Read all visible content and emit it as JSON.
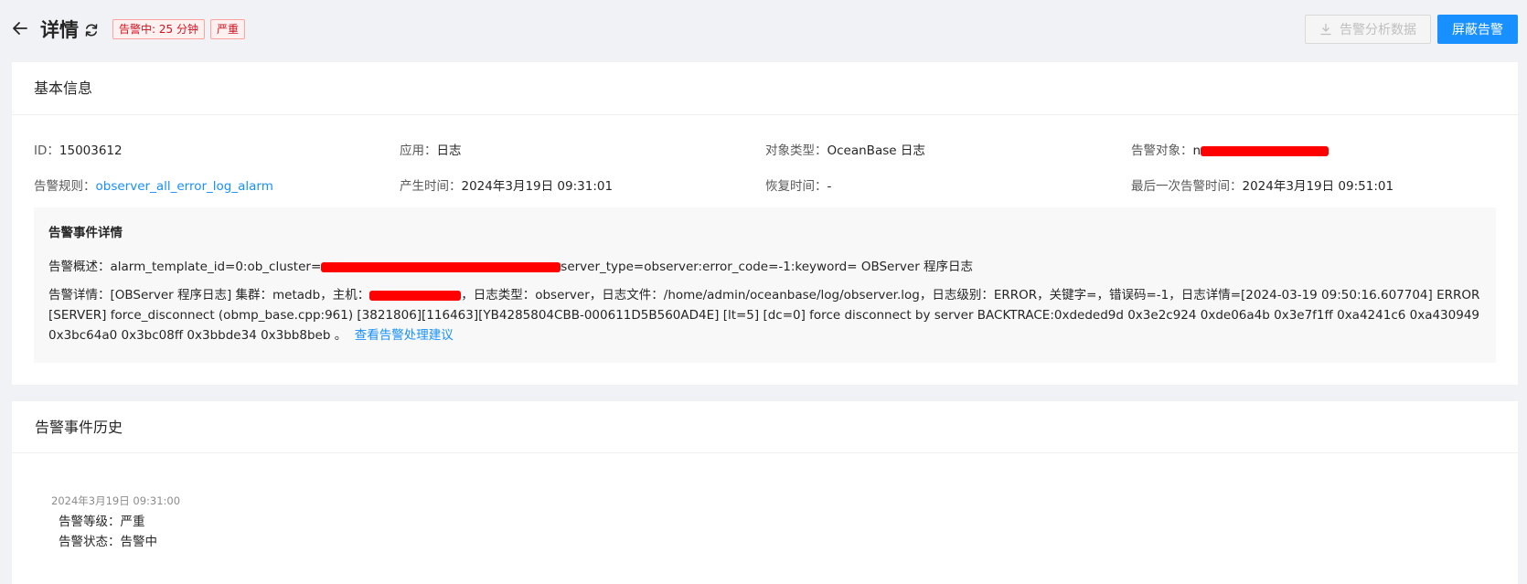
{
  "header": {
    "title": "详情",
    "tags": [
      "告警中: 25 分钟",
      "严重"
    ],
    "analysis_button": "告警分析数据",
    "mask_button": "屏蔽告警"
  },
  "basic": {
    "section_title": "基本信息",
    "id_label": "ID：",
    "id_value": "15003612",
    "app_label": "应用：",
    "app_value": "日志",
    "object_type_label": "对象类型：",
    "object_type_value": "OceanBase 日志",
    "target_label": "告警对象：",
    "target_prefix": "n",
    "rule_label": "告警规则：",
    "rule_value": "observer_all_error_log_alarm",
    "created_label": "产生时间：",
    "created_value": "2024年3月19日 09:31:01",
    "recovered_label": "恢复时间：",
    "recovered_value": "-",
    "last_label": "最后一次告警时间：",
    "last_value": "2024年3月19日 09:51:01"
  },
  "event": {
    "title": "告警事件详情",
    "summary_label": "告警概述：",
    "summary_before": "alarm_template_id=0:ob_cluster=",
    "summary_after": "server_type=observer:error_code=-1:keyword= OBServer 程序日志",
    "detail_label": "告警详情：",
    "detail_before": "[OBServer 程序日志] 集群：metadb，主机：",
    "detail_after": "，日志类型：observer，日志文件：/home/admin/oceanbase/log/observer.log，日志级别：ERROR，关键字=，错误码=-1，日志详情=[2024-03-19 09:50:16.607704] ERROR [SERVER] force_disconnect (obmp_base.cpp:961) [3821806][116463][YB4285804CBB-000611D5B560AD4E] [lt=5] [dc=0] force disconnect by server BACKTRACE:0xdeded9d 0x3e2c924 0xde06a4b 0x3e7f1ff 0xa4241c6 0xa430949 0x3bc64a0 0x3bc08ff 0x3bbde34 0x3bb8beb 。",
    "advice_link": "查看告警处理建议"
  },
  "history": {
    "section_title": "告警事件历史",
    "time": "2024年3月19日 09:31:00",
    "level_label": "告警等级：",
    "level_value": "严重",
    "status_label": "告警状态：",
    "status_value": "告警中"
  }
}
